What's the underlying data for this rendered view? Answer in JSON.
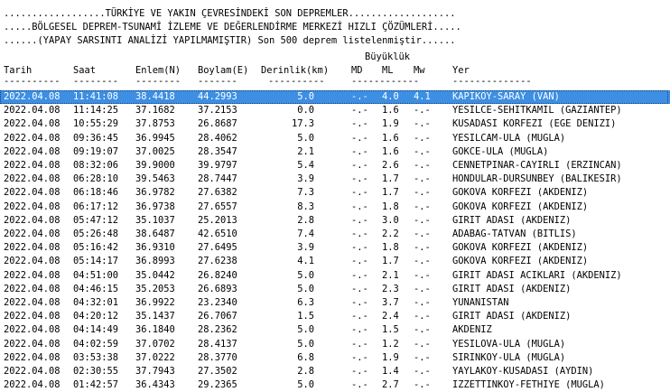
{
  "banner": {
    "line1": "..................TÜRKİYE VE YAKIN ÇEVRESİNDEKİ SON DEPREMLER...................",
    "line2": ".....BÖLGESEL DEPREM-TSUNAMİ İZLEME VE DEĞERLENDİRME MERKEZİ HIZLI ÇÖZÜMLERİ.....",
    "line3": "......(YAPAY SARSINTI ANALİZİ YAPILMAMIŞTIR) Son 500 deprem listelenmiştir......"
  },
  "table": {
    "magnitude_group_label": "Büyüklük",
    "headers": {
      "date": "Tarih",
      "time": "Saat",
      "lat": "Enlem(N)",
      "lon": "Boylam(E)",
      "depth": "Derinlik(km)",
      "md": "MD",
      "ml": "ML",
      "mw": "Mw",
      "place": "Yer"
    },
    "separators": {
      "date": "----------",
      "time": "--------",
      "lat": "--------",
      "lon": "-------",
      "depth": "----------",
      "mag": "------------",
      "place": "--------------"
    },
    "selected_index": 0,
    "rows": [
      {
        "date": "2022.04.08",
        "time": "11:41:08",
        "lat": "38.4418",
        "lon": "44.2993",
        "depth": "5.0",
        "md": "-.-",
        "ml": "4.0",
        "mw": "4.1",
        "place": "KAPIKOY-SARAY (VAN)"
      },
      {
        "date": "2022.04.08",
        "time": "11:14:25",
        "lat": "37.1682",
        "lon": "37.2153",
        "depth": "0.0",
        "md": "-.-",
        "ml": "1.6",
        "mw": "-.-",
        "place": "YESILCE-SEHITKAMIL (GAZIANTEP)"
      },
      {
        "date": "2022.04.08",
        "time": "10:55:29",
        "lat": "37.8753",
        "lon": "26.8687",
        "depth": "17.3",
        "md": "-.-",
        "ml": "1.9",
        "mw": "-.-",
        "place": "KUSADASI KORFEZI (EGE DENIZI)"
      },
      {
        "date": "2022.04.08",
        "time": "09:36:45",
        "lat": "36.9945",
        "lon": "28.4062",
        "depth": "5.0",
        "md": "-.-",
        "ml": "1.6",
        "mw": "-.-",
        "place": "YESILCAM-ULA (MUGLA)"
      },
      {
        "date": "2022.04.08",
        "time": "09:19:07",
        "lat": "37.0025",
        "lon": "28.3547",
        "depth": "2.1",
        "md": "-.-",
        "ml": "1.6",
        "mw": "-.-",
        "place": "GOKCE-ULA (MUGLA)"
      },
      {
        "date": "2022.04.08",
        "time": "08:32:06",
        "lat": "39.9000",
        "lon": "39.9797",
        "depth": "5.4",
        "md": "-.-",
        "ml": "2.6",
        "mw": "-.-",
        "place": "CENNETPINAR-CAYIRLI (ERZINCAN)"
      },
      {
        "date": "2022.04.08",
        "time": "06:28:10",
        "lat": "39.5463",
        "lon": "28.7447",
        "depth": "3.9",
        "md": "-.-",
        "ml": "1.7",
        "mw": "-.-",
        "place": "HONDULAR-DURSUNBEY (BALIKESIR)"
      },
      {
        "date": "2022.04.08",
        "time": "06:18:46",
        "lat": "36.9782",
        "lon": "27.6382",
        "depth": "7.3",
        "md": "-.-",
        "ml": "1.7",
        "mw": "-.-",
        "place": "GOKOVA KORFEZI (AKDENIZ)"
      },
      {
        "date": "2022.04.08",
        "time": "06:17:12",
        "lat": "36.9738",
        "lon": "27.6557",
        "depth": "8.3",
        "md": "-.-",
        "ml": "1.8",
        "mw": "-.-",
        "place": "GOKOVA KORFEZI (AKDENIZ)"
      },
      {
        "date": "2022.04.08",
        "time": "05:47:12",
        "lat": "35.1037",
        "lon": "25.2013",
        "depth": "2.8",
        "md": "-.-",
        "ml": "3.0",
        "mw": "-.-",
        "place": "GIRIT ADASI (AKDENIZ)"
      },
      {
        "date": "2022.04.08",
        "time": "05:26:48",
        "lat": "38.6487",
        "lon": "42.6510",
        "depth": "7.4",
        "md": "-.-",
        "ml": "2.2",
        "mw": "-.-",
        "place": "ADABAG-TATVAN (BITLIS)"
      },
      {
        "date": "2022.04.08",
        "time": "05:16:42",
        "lat": "36.9310",
        "lon": "27.6495",
        "depth": "3.9",
        "md": "-.-",
        "ml": "1.8",
        "mw": "-.-",
        "place": "GOKOVA KORFEZI (AKDENIZ)"
      },
      {
        "date": "2022.04.08",
        "time": "05:14:17",
        "lat": "36.8993",
        "lon": "27.6238",
        "depth": "4.1",
        "md": "-.-",
        "ml": "1.7",
        "mw": "-.-",
        "place": "GOKOVA KORFEZI (AKDENIZ)"
      },
      {
        "date": "2022.04.08",
        "time": "04:51:00",
        "lat": "35.0442",
        "lon": "26.8240",
        "depth": "5.0",
        "md": "-.-",
        "ml": "2.1",
        "mw": "-.-",
        "place": "GIRIT ADASI ACIKLARI (AKDENIZ)"
      },
      {
        "date": "2022.04.08",
        "time": "04:46:15",
        "lat": "35.2053",
        "lon": "26.6893",
        "depth": "5.0",
        "md": "-.-",
        "ml": "2.3",
        "mw": "-.-",
        "place": "GIRIT ADASI (AKDENIZ)"
      },
      {
        "date": "2022.04.08",
        "time": "04:32:01",
        "lat": "36.9922",
        "lon": "23.2340",
        "depth": "6.3",
        "md": "-.-",
        "ml": "3.7",
        "mw": "-.-",
        "place": "YUNANISTAN"
      },
      {
        "date": "2022.04.08",
        "time": "04:20:12",
        "lat": "35.1437",
        "lon": "26.7067",
        "depth": "1.5",
        "md": "-.-",
        "ml": "2.4",
        "mw": "-.-",
        "place": "GIRIT ADASI (AKDENIZ)"
      },
      {
        "date": "2022.04.08",
        "time": "04:14:49",
        "lat": "36.1840",
        "lon": "28.2362",
        "depth": "5.0",
        "md": "-.-",
        "ml": "1.5",
        "mw": "-.-",
        "place": "AKDENIZ"
      },
      {
        "date": "2022.04.08",
        "time": "04:02:59",
        "lat": "37.0702",
        "lon": "28.4137",
        "depth": "5.0",
        "md": "-.-",
        "ml": "1.2",
        "mw": "-.-",
        "place": "YESILOVA-ULA (MUGLA)"
      },
      {
        "date": "2022.04.08",
        "time": "03:53:38",
        "lat": "37.0222",
        "lon": "28.3770",
        "depth": "6.8",
        "md": "-.-",
        "ml": "1.9",
        "mw": "-.-",
        "place": "SIRINKOY-ULA (MUGLA)"
      },
      {
        "date": "2022.04.08",
        "time": "02:30:55",
        "lat": "37.7943",
        "lon": "27.3502",
        "depth": "2.8",
        "md": "-.-",
        "ml": "1.4",
        "mw": "-.-",
        "place": "YAYLAKOY-KUSADASI (AYDIN)"
      },
      {
        "date": "2022.04.08",
        "time": "01:42:57",
        "lat": "36.4343",
        "lon": "29.2365",
        "depth": "5.0",
        "md": "-.-",
        "ml": "2.7",
        "mw": "-.-",
        "place": "IZZETTINKOY-FETHIYE (MUGLA)"
      }
    ]
  }
}
